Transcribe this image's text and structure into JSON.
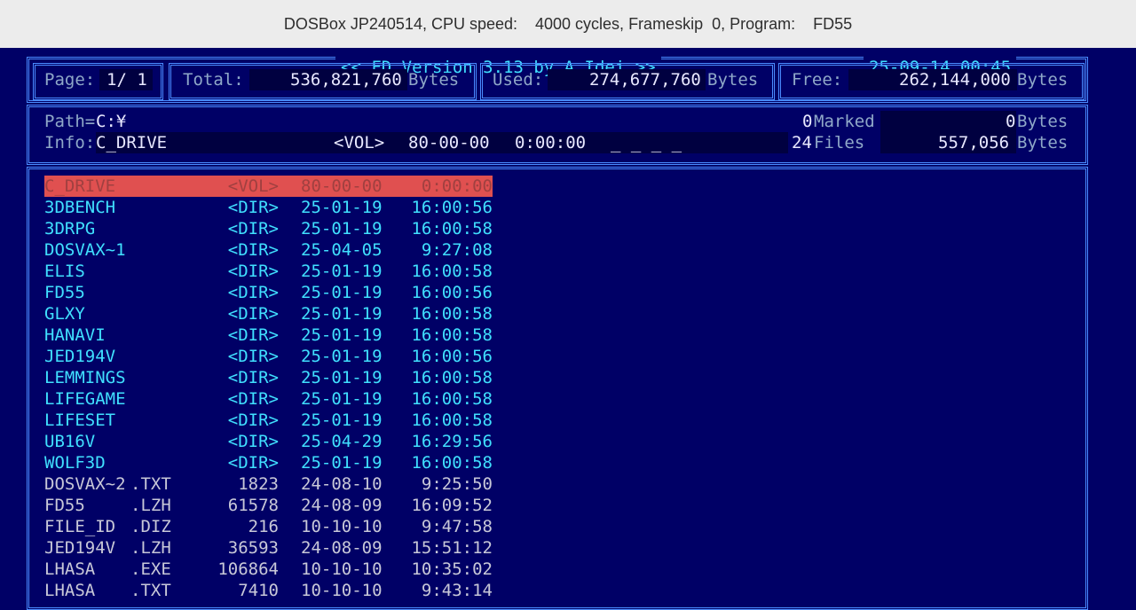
{
  "window": {
    "title": "DOSBox JP240514, CPU speed:    4000 cycles, Frameskip  0, Program:    FD55"
  },
  "header": {
    "title": "<< FD Version 3.13 by A.Idei >>",
    "datetime": "25-09-14 00:45",
    "page_label": "Page:",
    "page_value": "1/ 1",
    "total_label": "Total:",
    "total_value": "536,821,760",
    "total_unit": "Bytes",
    "used_label": "Used:",
    "used_value": "274,677,760",
    "used_unit": "Bytes",
    "free_label": "Free:",
    "free_value": "262,144,000",
    "free_unit": "Bytes"
  },
  "info": {
    "path_label": "Path=",
    "path_value": "C:¥",
    "info_label": "Info:",
    "info_name": "C_DRIVE",
    "info_type": "<VOL>",
    "info_date": "80-00-00",
    "info_time": "0:00:00",
    "info_attr": "_ _ _ _",
    "marked_count": "0",
    "marked_label": "Marked",
    "marked_bytes": "0",
    "bytes_label": "Bytes",
    "files_count": "24",
    "files_label": "Files",
    "files_bytes": "557,056",
    "files_bytes_label": "Bytes"
  },
  "files": [
    {
      "name": "C_DRIVE",
      "ext": "",
      "size": "<VOL>",
      "date": "80-00-00",
      "time": "0:00:00",
      "kind": "vol"
    },
    {
      "name": "3DBENCH",
      "ext": "",
      "size": "<DIR>",
      "date": "25-01-19",
      "time": "16:00:56",
      "kind": "dir"
    },
    {
      "name": "3DRPG",
      "ext": "",
      "size": "<DIR>",
      "date": "25-01-19",
      "time": "16:00:58",
      "kind": "dir"
    },
    {
      "name": "DOSVAX~1",
      "ext": "",
      "size": "<DIR>",
      "date": "25-04-05",
      "time": "9:27:08",
      "kind": "dir"
    },
    {
      "name": "ELIS",
      "ext": "",
      "size": "<DIR>",
      "date": "25-01-19",
      "time": "16:00:58",
      "kind": "dir"
    },
    {
      "name": "FD55",
      "ext": "",
      "size": "<DIR>",
      "date": "25-01-19",
      "time": "16:00:56",
      "kind": "dir"
    },
    {
      "name": "GLXY",
      "ext": "",
      "size": "<DIR>",
      "date": "25-01-19",
      "time": "16:00:58",
      "kind": "dir"
    },
    {
      "name": "HANAVI",
      "ext": "",
      "size": "<DIR>",
      "date": "25-01-19",
      "time": "16:00:58",
      "kind": "dir"
    },
    {
      "name": "JED194V",
      "ext": "",
      "size": "<DIR>",
      "date": "25-01-19",
      "time": "16:00:56",
      "kind": "dir"
    },
    {
      "name": "LEMMINGS",
      "ext": "",
      "size": "<DIR>",
      "date": "25-01-19",
      "time": "16:00:58",
      "kind": "dir"
    },
    {
      "name": "LIFEGAME",
      "ext": "",
      "size": "<DIR>",
      "date": "25-01-19",
      "time": "16:00:58",
      "kind": "dir"
    },
    {
      "name": "LIFESET",
      "ext": "",
      "size": "<DIR>",
      "date": "25-01-19",
      "time": "16:00:58",
      "kind": "dir"
    },
    {
      "name": "UB16V",
      "ext": "",
      "size": "<DIR>",
      "date": "25-04-29",
      "time": "16:29:56",
      "kind": "dir"
    },
    {
      "name": "WOLF3D",
      "ext": "",
      "size": "<DIR>",
      "date": "25-01-19",
      "time": "16:00:58",
      "kind": "dir"
    },
    {
      "name": "DOSVAX~2",
      "ext": ".TXT",
      "size": "1823",
      "date": "24-08-10",
      "time": "9:25:50",
      "kind": "file"
    },
    {
      "name": "FD55",
      "ext": ".LZH",
      "size": "61578",
      "date": "24-08-09",
      "time": "16:09:52",
      "kind": "file"
    },
    {
      "name": "FILE_ID",
      "ext": ".DIZ",
      "size": "216",
      "date": "10-10-10",
      "time": "9:47:58",
      "kind": "file"
    },
    {
      "name": "JED194V",
      "ext": ".LZH",
      "size": "36593",
      "date": "24-08-09",
      "time": "15:51:12",
      "kind": "file"
    },
    {
      "name": "LHASA",
      "ext": ".EXE",
      "size": "106864",
      "date": "10-10-10",
      "time": "10:35:02",
      "kind": "file"
    },
    {
      "name": "LHASA",
      "ext": ".TXT",
      "size": "7410",
      "date": "10-10-10",
      "time": "9:43:14",
      "kind": "file"
    }
  ],
  "colors": {
    "background": "#000066",
    "border": "#4a8cff",
    "directory": "#40e0ff",
    "file": "#c8c8d8",
    "selection": "#e05050"
  }
}
